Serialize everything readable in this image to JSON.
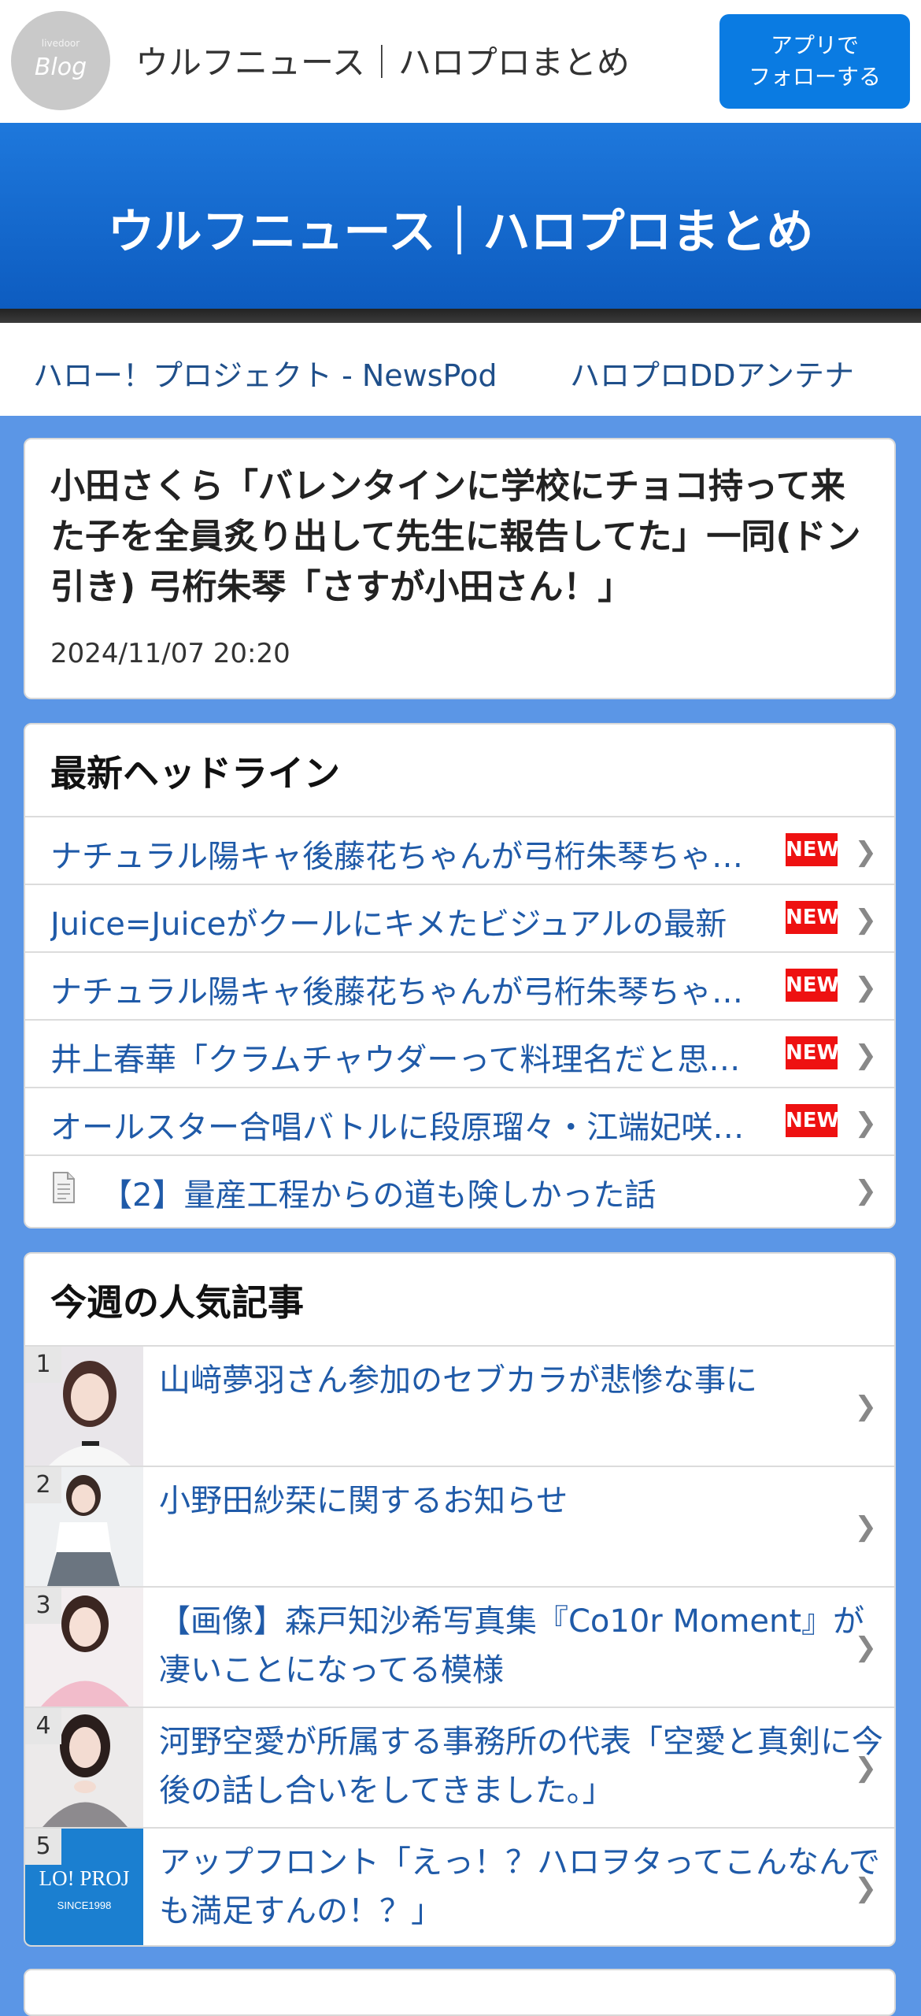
{
  "topbar": {
    "logo_small": "livedoor",
    "logo_big": "Blog",
    "title": "ウルフニュース｜ハロプロまとめ",
    "follow_line1": "アプリで",
    "follow_line2": "フォローする"
  },
  "banner": {
    "title": "ウルフニュース｜ハロプロまとめ"
  },
  "links": [
    "ハロー！プロジェクト - NewsPod",
    "ハロプロDDアンテナ"
  ],
  "article": {
    "title": "小田さくら「バレンタインに学校にチョコ持って来た子を全員炙り出して先生に報告してた」一同(ドン引き) 弓桁朱琴「さすが小田さん！」",
    "date": "2024/11/07 20:20"
  },
  "headlines": {
    "title": "最新ヘッドライン",
    "new_label": "NEW",
    "items": [
      "ナチュラル陽キャ後藤花ちゃんが弓桁朱琴ちゃんと",
      "Juice=Juiceがクールにキメたビジュアルの最新",
      "ナチュラル陽キャ後藤花ちゃんが弓桁朱琴ちゃんと",
      "井上春華「クラムチャウダーって料理名だと思って",
      "オールスター合唱バトルに段原瑠々・江端妃咲が出"
    ],
    "doc_item": "【2】量産工程からの道も険しかった話"
  },
  "popular": {
    "title": "今週の人気記事",
    "items": [
      {
        "rank": "1",
        "text": "山﨑夢羽さん参加のセブカラが悲惨な事に"
      },
      {
        "rank": "2",
        "text": "小野田紗栞に関するお知らせ"
      },
      {
        "rank": "3",
        "text": "【画像】森戸知沙希写真集『Co10r Moment』が凄いことになってる模様"
      },
      {
        "rank": "4",
        "text": "河野空愛が所属する事務所の代表「空愛と真剣に今後の話し合いをしてきました。」"
      },
      {
        "rank": "5",
        "text": "アップフロント「えっ！？ハロヲタってこんなんでも満足すんの！？」",
        "thumb_text": "LO! PROJ",
        "thumb_sub": "SINCE1998"
      }
    ]
  },
  "colors": {
    "page_bg": "#5b96e6",
    "banner": "#1e78dc",
    "follow": "#0a7be2",
    "link": "#1f5aa8",
    "new_badge": "#ee1111"
  }
}
